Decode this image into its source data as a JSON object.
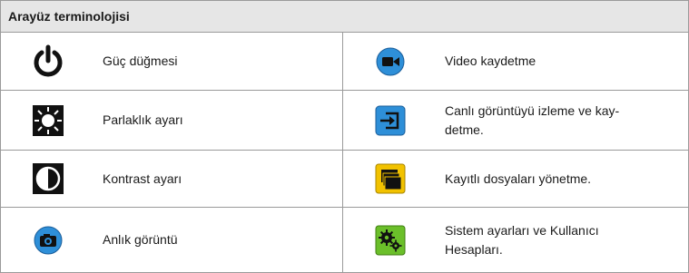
{
  "header": {
    "title": "Arayüz terminolojisi"
  },
  "rows": [
    {
      "left_icon": "power-icon",
      "left_label": "Güç düğmesi",
      "right_icon": "video-record-icon",
      "right_label": "Video kaydetme"
    },
    {
      "left_icon": "brightness-icon",
      "left_label": "Parlaklık ayarı",
      "right_icon": "live-view-icon",
      "right_label": "Canlı görüntüyü izleme ve kay-\ndetme."
    },
    {
      "left_icon": "contrast-icon",
      "left_label": "Kontrast ayarı",
      "right_icon": "folders-icon",
      "right_label": "Kayıtlı dosyaları yönetme."
    },
    {
      "left_icon": "camera-icon",
      "left_label": "Anlık görüntü",
      "right_icon": "settings-gears-icon",
      "right_label": "Sistem ayarları ve Kullanıcı\nHesapları."
    }
  ],
  "colors": {
    "header_bg": "#e6e6e6",
    "border": "#9a9a9a",
    "blue": "#2e8fd8",
    "yellow": "#f2c200",
    "green": "#6bbf2a"
  }
}
